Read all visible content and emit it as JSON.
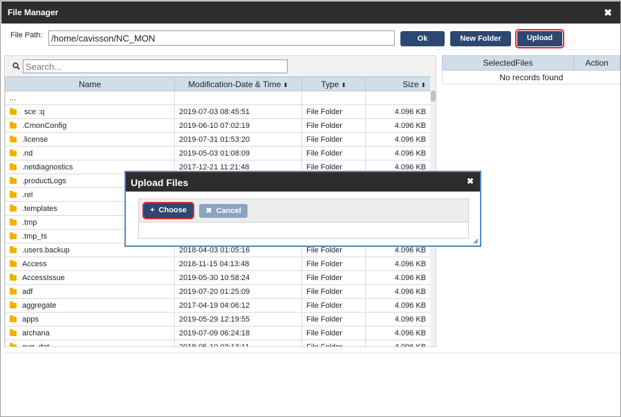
{
  "window": {
    "title": "File Manager",
    "close": "✖"
  },
  "path": {
    "label": "File Path:",
    "value": "/home/cavisson/NC_MON"
  },
  "buttons": {
    "ok": "Ok",
    "new_folder": "New Folder",
    "upload": "Upload"
  },
  "search": {
    "placeholder": "Search..."
  },
  "columns": {
    "name": "Name",
    "modified": "Modification-Date & Time",
    "type": "Type",
    "size": "Size",
    "sort_glyph": "⬍"
  },
  "parent_row": "...",
  "files": [
    {
      "name": " sce :q",
      "date": "2019-07-03 08:45:51",
      "type": "File Folder",
      "size": "4.096 KB"
    },
    {
      "name": ".CmonConfig",
      "date": "2019-06-10 07:02:19",
      "type": "File Folder",
      "size": "4.096 KB"
    },
    {
      "name": ".license",
      "date": "2019-07-31 01:53:20",
      "type": "File Folder",
      "size": "4.096 KB"
    },
    {
      "name": ".nd",
      "date": "2019-05-03 01:08:09",
      "type": "File Folder",
      "size": "4.096 KB"
    },
    {
      "name": ".netdiagnostics",
      "date": "2017-12-21 11:21:48",
      "type": "File Folder",
      "size": "4.096 KB"
    },
    {
      "name": ".productLogs",
      "date": "",
      "type": "",
      "size": ""
    },
    {
      "name": ".rel",
      "date": "",
      "type": "",
      "size": ""
    },
    {
      "name": ".templates",
      "date": "",
      "type": "",
      "size": ""
    },
    {
      "name": ".tmp",
      "date": "",
      "type": "",
      "size": ""
    },
    {
      "name": ".tmp_ts",
      "date": "",
      "type": "",
      "size": ""
    },
    {
      "name": ".users.backup",
      "date": "2018-04-03 01:05:16",
      "type": "File Folder",
      "size": "4.096 KB"
    },
    {
      "name": "Access",
      "date": "2018-11-15 04:13:48",
      "type": "File Folder",
      "size": "4.096 KB"
    },
    {
      "name": "AccessIssue",
      "date": "2019-05-30 10:58:24",
      "type": "File Folder",
      "size": "4.096 KB"
    },
    {
      "name": "adf",
      "date": "2019-07-20 01:25:09",
      "type": "File Folder",
      "size": "4.096 KB"
    },
    {
      "name": "aggregate",
      "date": "2017-04-19 04:06:12",
      "type": "File Folder",
      "size": "4.096 KB"
    },
    {
      "name": "apps",
      "date": "2019-05-29 12:19:55",
      "type": "File Folder",
      "size": "4.096 KB"
    },
    {
      "name": "archana",
      "date": "2019-07-09 06:24:18",
      "type": "File Folder",
      "size": "4.096 KB"
    },
    {
      "name": "avg_dat",
      "date": "2018-05-10 03:13:11",
      "type": "File Folder",
      "size": "4.096 KB"
    }
  ],
  "selected": {
    "col_files": "SelectedFiles",
    "col_action": "Action",
    "empty": "No records found"
  },
  "dialog": {
    "title": "Upload Files",
    "close": "✖",
    "choose": "Choose",
    "choose_icon": "+",
    "cancel": "Cancel",
    "cancel_icon": "✖"
  },
  "icons": {
    "search": "search-icon",
    "folder": "folder-icon",
    "resize": "resize-grip-icon"
  },
  "colors": {
    "accent": "#2c4770",
    "highlight": "#e0262f",
    "header": "#d1dde9",
    "titlebar": "#2d2d2d",
    "folder": "#f0b100"
  }
}
